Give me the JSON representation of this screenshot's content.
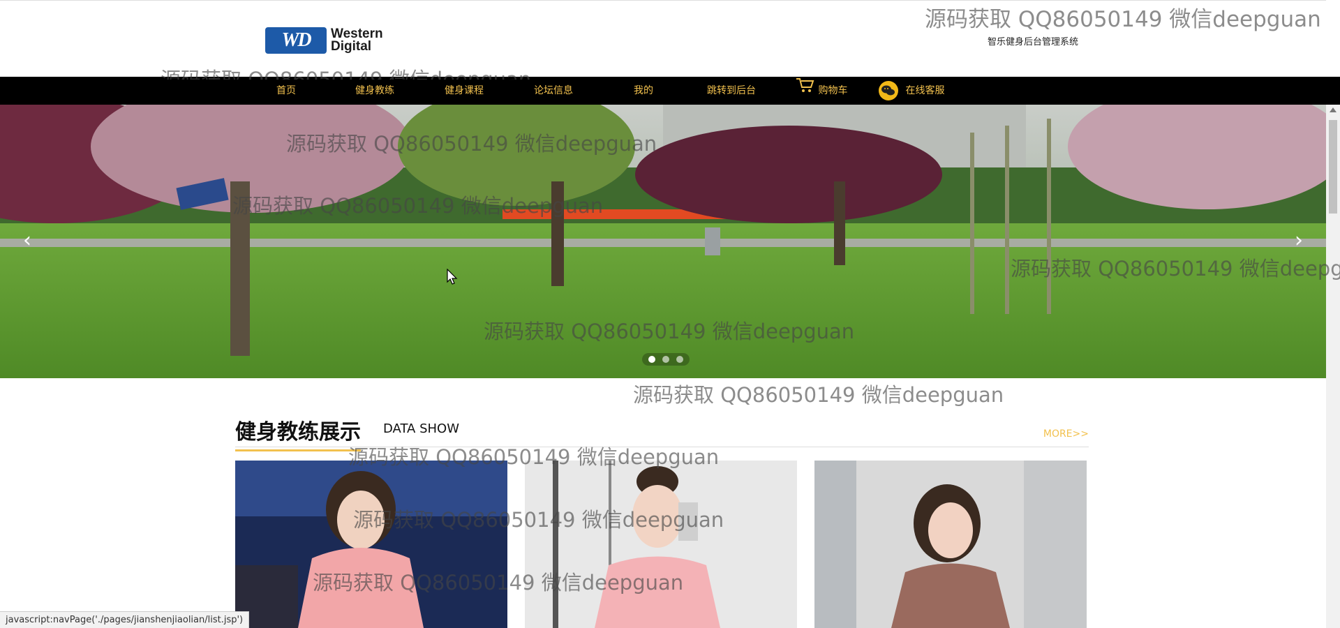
{
  "header": {
    "logo_text_line1": "Western",
    "logo_text_line2": "Digital",
    "logo_mark": "WD",
    "system_title": "智乐健身后台管理系统"
  },
  "nav": {
    "items": [
      {
        "label": "首页"
      },
      {
        "label": "健身教练"
      },
      {
        "label": "健身课程"
      },
      {
        "label": "论坛信息"
      },
      {
        "label": "我的"
      },
      {
        "label": "跳转到后台"
      },
      {
        "label": "购物车",
        "icon": "cart-icon"
      },
      {
        "label": "在线客服",
        "icon": "chat-icon"
      }
    ],
    "accent_color": "#f2c14e"
  },
  "banner": {
    "prev_arrow": "‹",
    "next_arrow": "›",
    "slide_count": 3,
    "active_slide": 1
  },
  "section": {
    "title": "健身教练展示",
    "subtitle": "DATA SHOW",
    "more_label": "MORE>>"
  },
  "cards": [
    {
      "name": "coach-1"
    },
    {
      "name": "coach-2"
    },
    {
      "name": "coach-3"
    }
  ],
  "watermark": "源码获取 QQ86050149 微信deepguan",
  "status_bar": "javascript:navPage('./pages/jianshenjiaolian/list.jsp')"
}
